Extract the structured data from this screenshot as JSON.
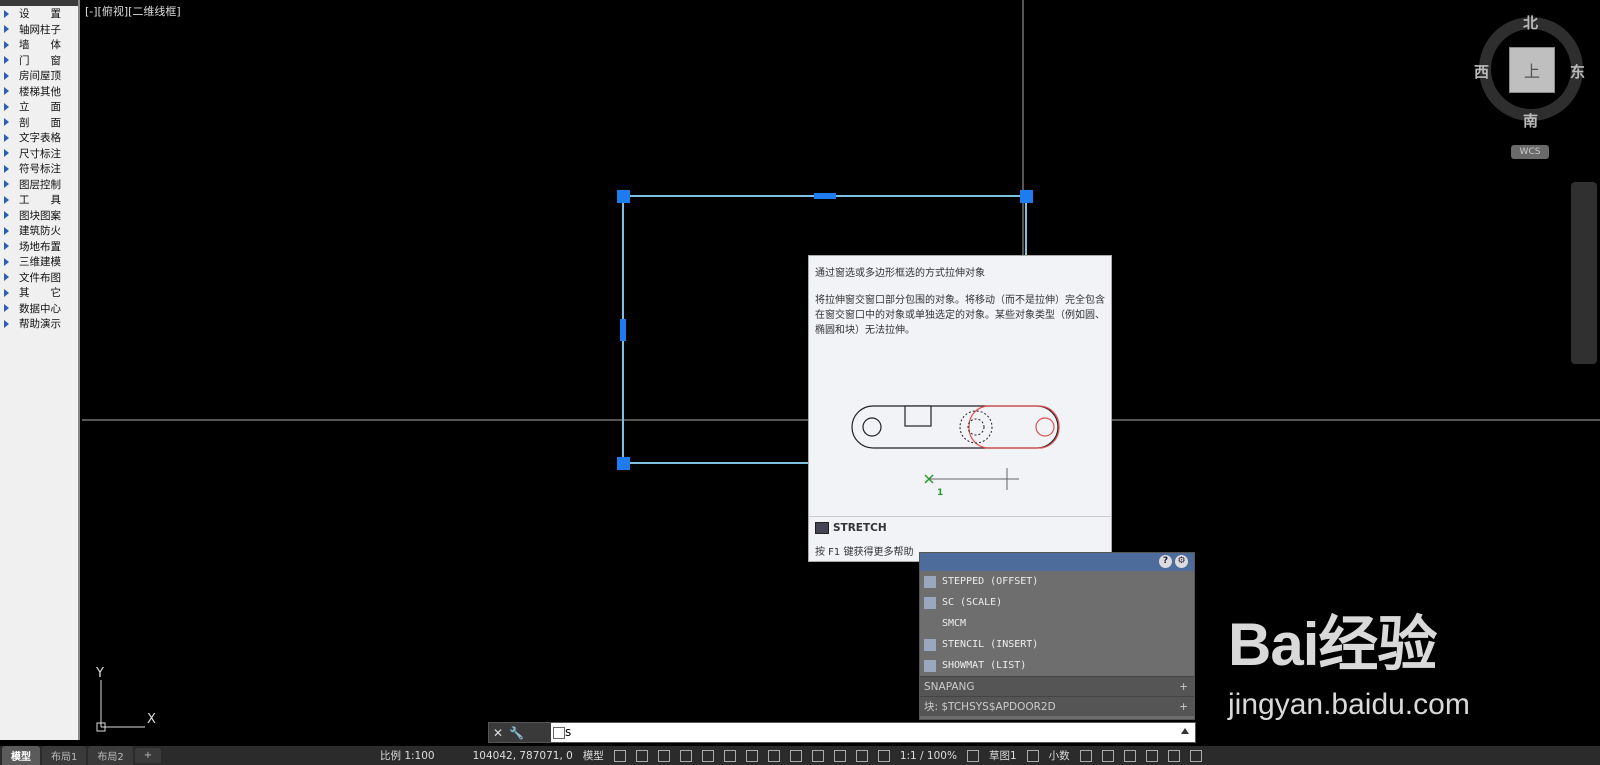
{
  "sidebar": {
    "items": [
      "设　　置",
      "轴网柱子",
      "墙　　体",
      "门　　窗",
      "房间屋顶",
      "楼梯其他",
      "立　　面",
      "剖　　面",
      "文字表格",
      "尺寸标注",
      "符号标注",
      "图层控制",
      "工　　具",
      "图块图案",
      "建筑防火",
      "场地布置",
      "三维建模",
      "文件布图",
      "其　　它",
      "数据中心",
      "帮助演示"
    ]
  },
  "viewport": {
    "label": "[-][俯视][二维线框]",
    "compass": {
      "n": "北",
      "s": "南",
      "w": "西",
      "e": "东",
      "cube": "上"
    },
    "wcs": "WCS",
    "ucs_x": "X",
    "ucs_y": "Y"
  },
  "tooltip": {
    "title": "通过窗选或多边形框选的方式拉伸对象",
    "body": "将拉伸窗交窗口部分包围的对象。将移动（而不是拉伸）完全包含在窗交窗口中的对象或单独选定的对象。某些对象类型（例如圆、椭圆和块）无法拉伸。",
    "command": "STRETCH",
    "help": "按 F1 键获得更多帮助",
    "illustration_marker": "1"
  },
  "autocomplete": {
    "items": [
      "STEPPED (OFFSET)",
      "SC (SCALE)",
      "SMCM",
      "STENCIL (INSERT)",
      "SHOWMAT (LIST)"
    ],
    "sections": [
      "SNAPANG",
      "块: $TCHSYS$APDOOR2D"
    ]
  },
  "cmdline": {
    "value": "s"
  },
  "tabs": [
    "模型",
    "布局1",
    "布局2",
    "+"
  ],
  "status": {
    "scale": "比例 1:100",
    "coords": "104042, 787071, 0",
    "space": "模型",
    "anno_scale": "1:1 / 100%",
    "workspace": "草图1",
    "units": "小数"
  },
  "watermark": {
    "logo": "Bai经验",
    "url": "jingyan.baidu.com"
  },
  "colors": {
    "grip": "#1e7cf0",
    "selection": "#7fbfe0",
    "accent": "#4d6c9c"
  }
}
